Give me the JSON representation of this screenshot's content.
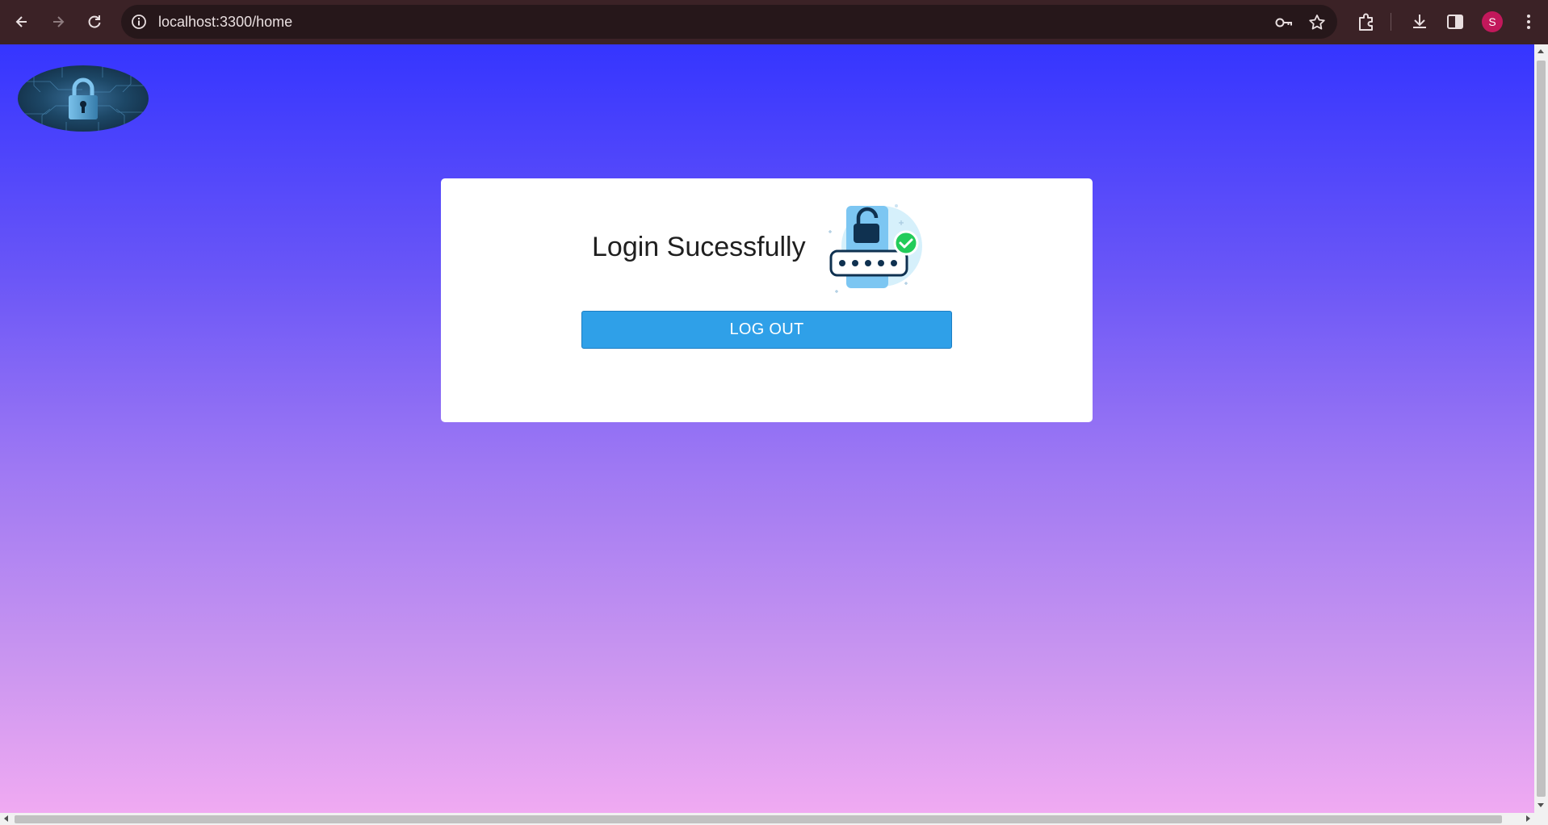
{
  "browser": {
    "url": "localhost:3300/home",
    "profile_initial": "S",
    "icons": {
      "back": "arrow-left-icon",
      "forward": "arrow-right-icon",
      "reload": "reload-icon",
      "site_info": "info-icon",
      "password": "key-icon",
      "bookmark": "star-icon",
      "extensions": "puzzle-icon",
      "downloads": "download-icon",
      "side_panel": "side-panel-icon",
      "menu": "kebab-menu-icon"
    }
  },
  "page": {
    "logo": "padlock-logo-icon",
    "card": {
      "title": "Login Sucessfully",
      "illustration": "unlocked-password-check-icon",
      "logout_label": "LOG OUT"
    }
  },
  "colors": {
    "gradient_top": "#3535ff",
    "gradient_bottom": "#f0aaf2",
    "button": "#2fa0e8",
    "check": "#22cc5a"
  }
}
